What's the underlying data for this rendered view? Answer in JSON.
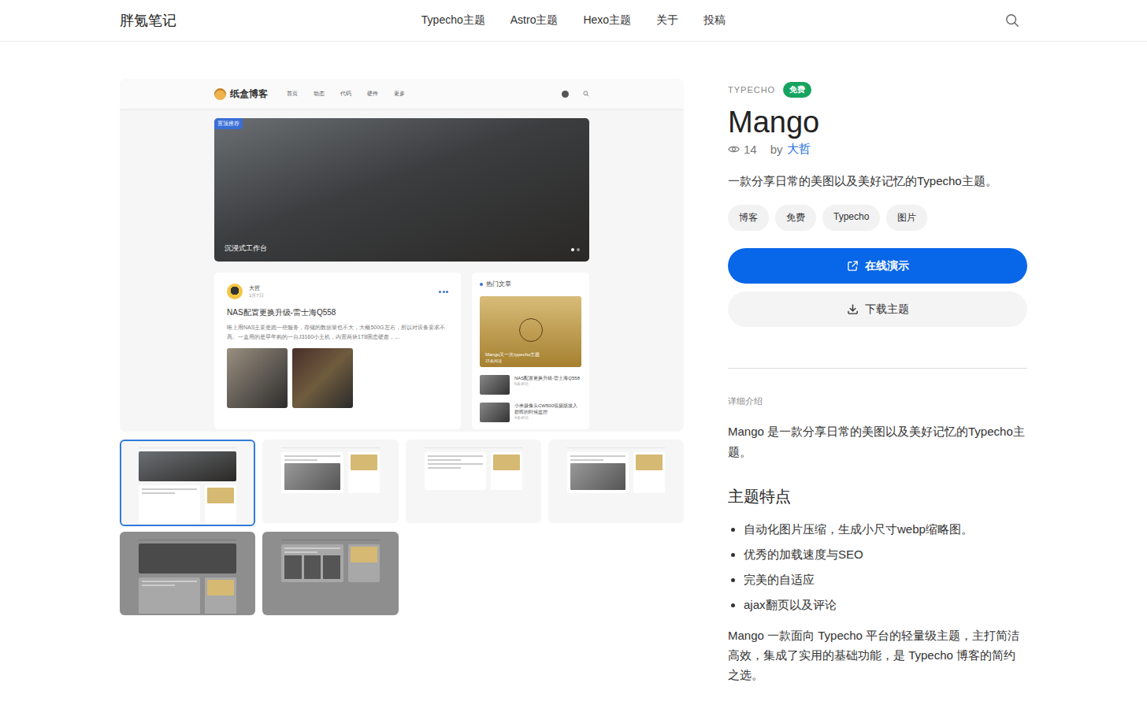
{
  "header": {
    "logo": "胖氪笔记",
    "nav": [
      {
        "label": "Typecho主题",
        "selected": false
      },
      {
        "label": "Astro主题",
        "selected": false
      },
      {
        "label": "Hexo主题",
        "selected": false
      },
      {
        "label": "关于",
        "selected": false
      },
      {
        "label": "投稿",
        "selected": false
      }
    ]
  },
  "gallery": {
    "preview": {
      "logo": "纸盒博客",
      "nav": [
        "首页",
        "动态",
        "代码",
        "硬件",
        "更多"
      ],
      "banner": {
        "tag": "置顶推荐",
        "caption": "沉浸式工作台",
        "dots": [
          {
            "selected": true
          },
          {
            "selected": false
          }
        ]
      },
      "post": {
        "author": "大哲",
        "time": "1月7日",
        "title": "NAS配置更换升级-雷士海Q558",
        "excerpt": "唯上用NAS主要是跑一些服务，存储的数据量也不大，大概500G左右，所以对设备要求不高。一直用的是早年购的一台J3160小主机，内置两块1T8固态硬盘，..."
      },
      "hot": {
        "title": "热门文章",
        "featured": {
          "title": "Mango又一次typecho主题",
          "meta": "15条阅读"
        },
        "items": [
          {
            "title": "NAS配置更换升级-雷士海Q558",
            "meta": "6条评论"
          },
          {
            "title": "小米摄像头CW500双摄版接入群晖的时候监控",
            "meta": "4条评论"
          }
        ]
      }
    },
    "thumbnails": [
      {
        "selected": true,
        "dimmed": false,
        "kind": "banner"
      },
      {
        "selected": false,
        "dimmed": false,
        "kind": "list"
      },
      {
        "selected": false,
        "dimmed": false,
        "kind": "text"
      },
      {
        "selected": false,
        "dimmed": false,
        "kind": "photo"
      },
      {
        "selected": false,
        "dimmed": true,
        "kind": "banner"
      },
      {
        "selected": false,
        "dimmed": true,
        "kind": "gallery"
      }
    ]
  },
  "theme": {
    "category": "TYPECHO",
    "badge": "免费",
    "title": "Mango",
    "views": "14",
    "by": "by",
    "author": "大哲",
    "summary": "一款分享日常的美图以及美好记忆的Typecho主题。",
    "tags": [
      "博客",
      "免费",
      "Typecho",
      "图片"
    ],
    "buttons": [
      {
        "label": "在线演示",
        "kind": "primary"
      },
      {
        "label": "下载主题",
        "kind": "secondary"
      }
    ],
    "detail_label": "详细介绍",
    "intro": "Mango 是一款分享日常的美图以及美好记忆的Typecho主题。",
    "features_title": "主题特点",
    "features": [
      "自动化图片压缩，生成小尺寸webp缩略图。",
      "优秀的加载速度与SEO",
      "完美的自适应",
      "ajax翻页以及评论"
    ],
    "outro": "Mango 一款面向 Typecho 平台的轻量级主题，主打简洁高效，集成了实用的基础功能，是 Typecho 博客的简约之选。"
  }
}
